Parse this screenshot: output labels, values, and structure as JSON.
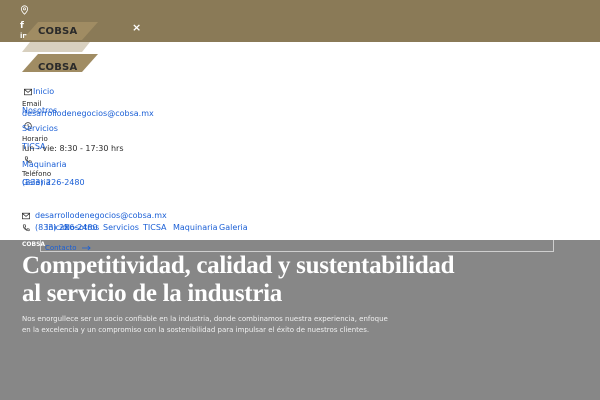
{
  "brand": {
    "name": "COBSA"
  },
  "colors": {
    "topbar": "#8a7a57",
    "link": "#1a5fd6",
    "hero_bg": "#878787"
  },
  "topbar": {
    "icons": [
      "map-pin-icon",
      "facebook-icon",
      "linkedin-icon",
      "close-icon"
    ],
    "facebook_glyph": "f",
    "linkedin_glyph": "in",
    "close_glyph": "×"
  },
  "nav": {
    "items": [
      "Inicio",
      "Nosotros",
      "Servicios",
      "TICSA",
      "Maquinaria",
      "Galeria"
    ],
    "contacto": "Contacto"
  },
  "contact": {
    "email_label": "Email",
    "email": "desarrollodenegocios@cobsa.mx",
    "hours_label": "Horario",
    "hours": "lun - vie: 8:30 - 17:30 hrs",
    "phone_label": "Teléfono",
    "phone": "(833) 226-2480"
  },
  "contact_bar": {
    "email": "desarrollodenegocios@cobsa.mx",
    "phone": "(833) 226-2480"
  },
  "hero": {
    "title_line1": "Competitividad, calidad y sustentabilidad",
    "title_line2": "al servicio de la industria",
    "subtitle": "Nos enorgullece ser un socio confiable en la industria, donde combinamos nuestra experiencia, enfoque en la excelencia y un compromiso con la sostenibilidad para impulsar el éxito de nuestros clientes."
  }
}
